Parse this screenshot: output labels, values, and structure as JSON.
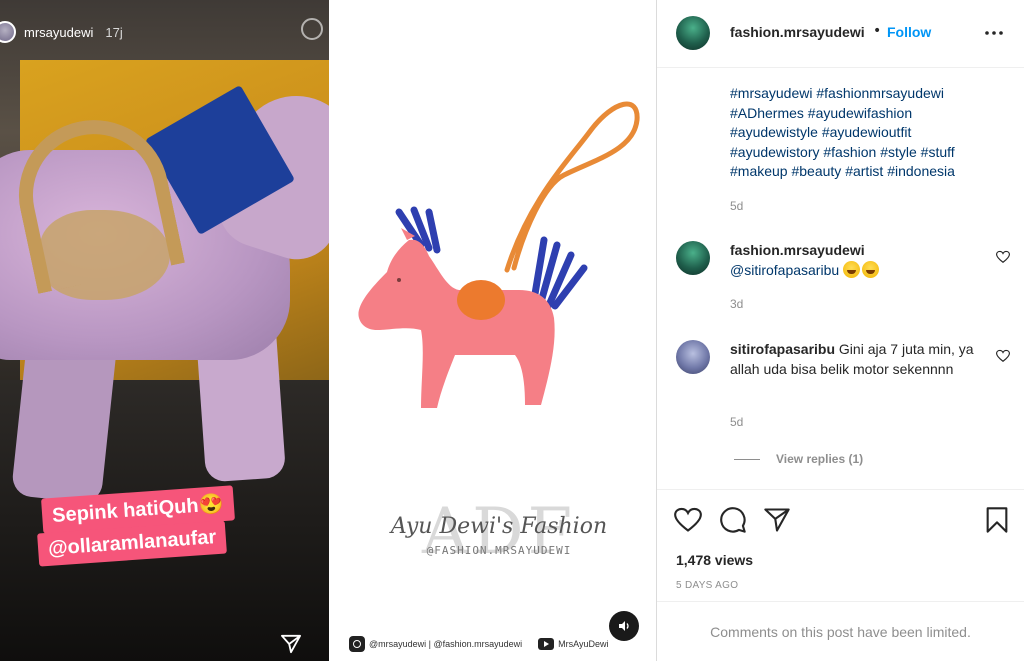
{
  "story": {
    "username": "mrsayudewi",
    "time": "17j",
    "stickers": [
      "Sepink hatiQuh😍",
      "@ollaramlanaufar"
    ]
  },
  "product": {
    "brand_name": "Ayu Dewi's Fashion",
    "brand_letters": "ADF",
    "brand_handle": "@FASHION.MRSAYUDEWI",
    "footer_instagram": "@mrsayudewi | @fashion.mrsayudewi",
    "footer_youtube": "MrsAyuDewi"
  },
  "post": {
    "username": "fashion.mrsayudewi",
    "follow_label": "Follow",
    "caption": "#mrsayudewi #fashionmrsayudewi #ADhermes #ayudewifashion #ayudewistyle #ayudewioutfit #ayudewistory #fashion #style #stuff #makeup #beauty #artist #indonesia",
    "caption_time": "5d",
    "comments": [
      {
        "username": "fashion.mrsayudewi",
        "text": "@sitirofapasaribu",
        "time": "3d"
      },
      {
        "username": "sitirofapasaribu",
        "text": "Gini aja 7 juta min, ya allah uda bisa belik motor sekennnn",
        "time": "5d"
      }
    ],
    "view_replies_label": "View replies (1)",
    "views": "1,478 views",
    "date": "5 DAYS AGO",
    "limited_text": "Comments on this post have been limited."
  },
  "icons": [
    "heart-icon",
    "comment-icon",
    "share-icon",
    "bookmark-icon",
    "more-icon",
    "sound-icon",
    "send-icon"
  ],
  "colors": {
    "follow": "#0095f6",
    "hashtag": "#00376b",
    "muted": "#8e8e8e",
    "sticker": "#f6557a"
  }
}
